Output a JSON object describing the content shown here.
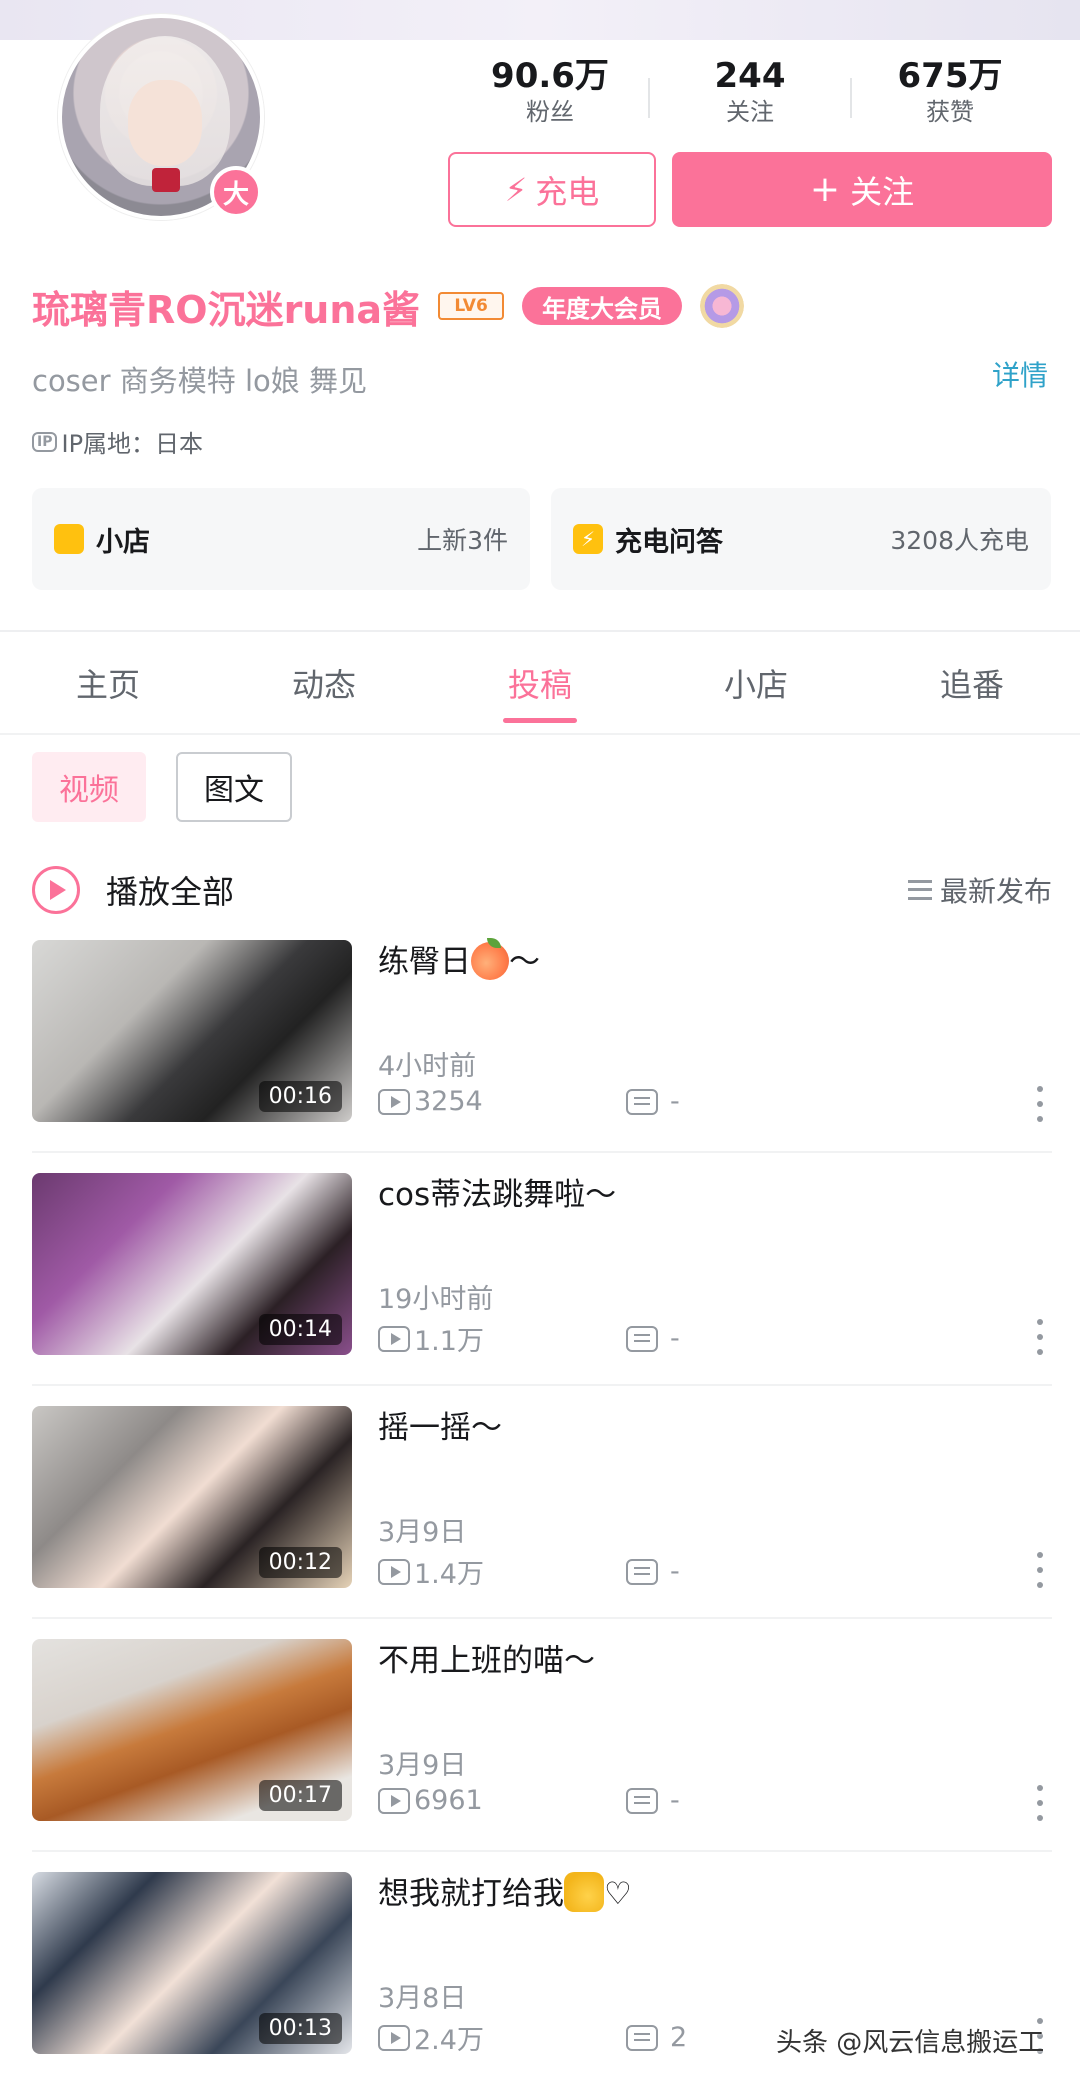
{
  "profile": {
    "badge": "大",
    "name": "琉璃青RO沉迷runa酱",
    "level": "LV6",
    "vip": "年度大会员",
    "sign": "coser 商务模特 lo娘 舞见",
    "detail": "详情",
    "ip_icon": "IP",
    "ip": "IP属地：日本"
  },
  "stats": [
    {
      "num": "90.6万",
      "label": "粉丝"
    },
    {
      "num": "244",
      "label": "关注"
    },
    {
      "num": "675万",
      "label": "获赞"
    }
  ],
  "buttons": {
    "charge": "充电",
    "follow": "关注"
  },
  "cards": {
    "shop": {
      "title": "小店",
      "meta": "上新3件"
    },
    "qa": {
      "title": "充电问答",
      "meta": "3208人充电"
    }
  },
  "tabs": [
    "主页",
    "动态",
    "投稿",
    "小店",
    "追番"
  ],
  "active_tab": "投稿",
  "chips": {
    "video": "视频",
    "article": "图文"
  },
  "list_header": {
    "play_all": "播放全部",
    "sort": "最新发布"
  },
  "videos": [
    {
      "title": "练臀日",
      "suffix": "～",
      "time": "4小时前",
      "views": "3254",
      "comments": "-",
      "duration": "00:16"
    },
    {
      "title": "cos蒂法跳舞啦～",
      "suffix": "",
      "time": "19小时前",
      "views": "1.1万",
      "comments": "-",
      "duration": "00:14"
    },
    {
      "title": "摇一摇～",
      "suffix": "",
      "time": "3月9日",
      "views": "1.4万",
      "comments": "-",
      "duration": "00:12"
    },
    {
      "title": "不用上班的喵～",
      "suffix": "",
      "time": "3月9日",
      "views": "6961",
      "comments": "-",
      "duration": "00:17"
    },
    {
      "title": "想我就打给我",
      "suffix": "♡",
      "time": "3月8日",
      "views": "2.4万",
      "comments": "2",
      "duration": "00:13"
    }
  ],
  "watermark": "头条 @风云信息搬运工",
  "colors": {
    "accent": "#fb7299",
    "link": "#2fa2c9",
    "shop_icon": "#ffc10f"
  }
}
